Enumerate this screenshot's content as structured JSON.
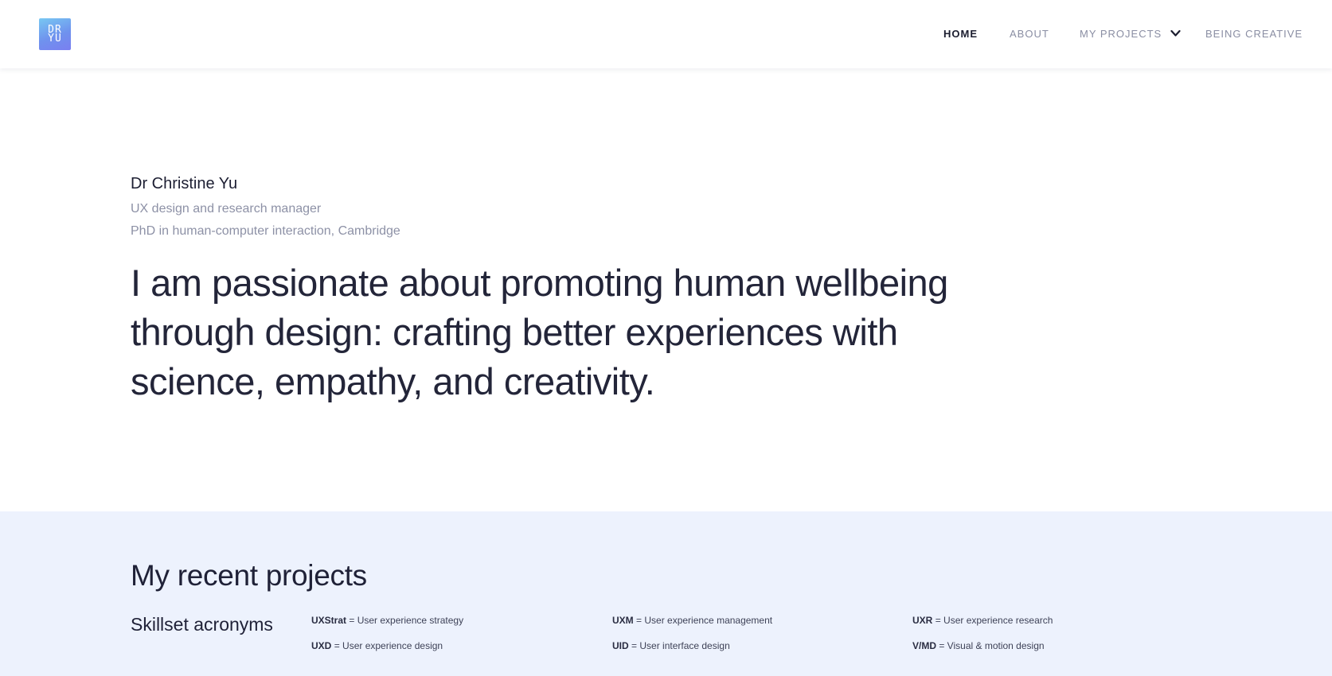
{
  "header": {
    "logo_text": "DR\nYU",
    "nav": [
      {
        "label": "HOME",
        "active": true
      },
      {
        "label": "ABOUT",
        "active": false
      },
      {
        "label": "MY PROJECTS",
        "active": false,
        "has_dropdown": true
      },
      {
        "label": "BEING CREATIVE",
        "active": false
      }
    ]
  },
  "hero": {
    "name": "Dr Christine Yu",
    "role": "UX design and research manager",
    "degree": "PhD in human-computer interaction, Cambridge",
    "statement": "I am passionate about promoting human wellbeing through design: crafting better experiences with science, empathy, and creativity."
  },
  "projects": {
    "title": "My recent projects",
    "skills_title": "Skillset acronyms",
    "acronyms": [
      {
        "abbr": "UXStrat",
        "meaning": "= User experience strategy"
      },
      {
        "abbr": "UXM",
        "meaning": "= User experience management"
      },
      {
        "abbr": "UXR",
        "meaning": "= User experience research"
      },
      {
        "abbr": "UXD",
        "meaning": "= User experience design"
      },
      {
        "abbr": "UID",
        "meaning": "= User interface design"
      },
      {
        "abbr": "V/MD",
        "meaning": "= Visual & motion design"
      }
    ]
  },
  "colors": {
    "projects_bg": "#edf2fd",
    "nav_inactive": "#8a8ea3",
    "nav_active": "#1b1d2f",
    "logo_gradient_start": "#78c8f2",
    "logo_gradient_end": "#7a7ff0"
  }
}
